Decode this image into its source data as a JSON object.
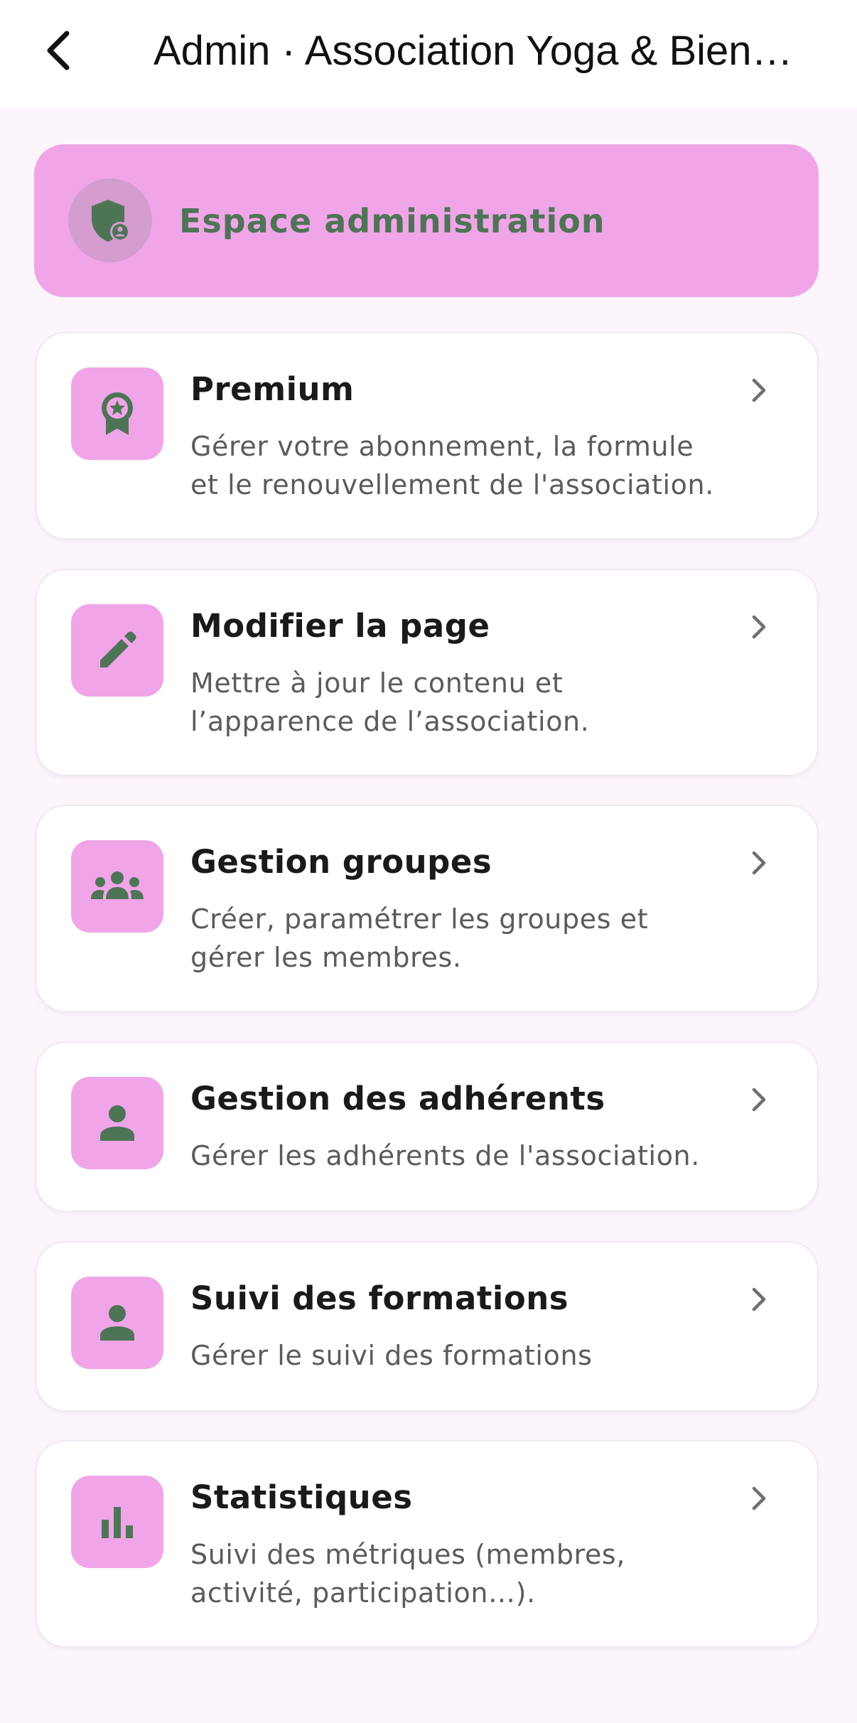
{
  "header": {
    "title": "Admin · Association Yoga & Bien…",
    "back_icon": "chevron-left-icon"
  },
  "hero": {
    "label": "Espace administration",
    "icon": "admin-shield-icon"
  },
  "colors": {
    "accent": "#f0a5e8",
    "icon_green": "#4e7456",
    "background": "#fcf5fc",
    "card": "#ffffff"
  },
  "items": [
    {
      "title": "Premium",
      "description": "Gérer votre abonnement, la formule\net le renouvellement de l'association.",
      "icon": "award-badge-icon"
    },
    {
      "title": "Modifier la page",
      "description": "Mettre à jour le contenu et\nl’apparence de l’association.",
      "icon": "pencil-icon"
    },
    {
      "title": "Gestion groupes",
      "description": "Créer, paramétrer les groupes et\ngérer les membres.",
      "icon": "groups-icon"
    },
    {
      "title": "Gestion des adhérents",
      "description": "Gérer les adhérents de l'association.",
      "icon": "person-icon"
    },
    {
      "title": "Suivi des formations",
      "description": "Gérer le suivi des formations",
      "icon": "person-icon"
    },
    {
      "title": "Statistiques",
      "description": "Suivi des métriques (membres,\nactivité, participation…).",
      "icon": "bar-chart-icon"
    }
  ]
}
